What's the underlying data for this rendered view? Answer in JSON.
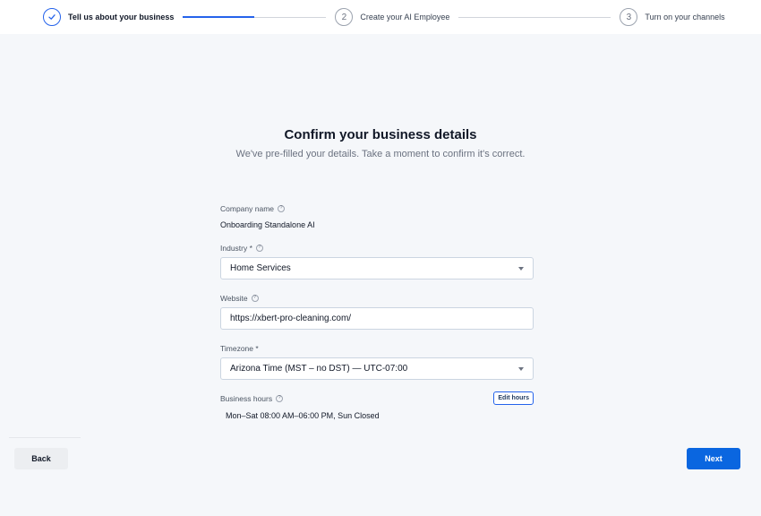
{
  "stepper": {
    "steps": [
      {
        "number": "",
        "label": "Tell us about your business",
        "state": "completed"
      },
      {
        "number": "2",
        "label": "Create your AI Employee",
        "state": "upcoming"
      },
      {
        "number": "3",
        "label": "Turn on your channels",
        "state": "upcoming"
      }
    ],
    "progress": 0.5
  },
  "page": {
    "title": "Confirm your business details",
    "subtitle": "We've pre-filled your details. Take a moment to confirm it's correct."
  },
  "form": {
    "company_name": {
      "label": "Company name",
      "value": "Onboarding Standalone AI"
    },
    "industry": {
      "label": "Industry *",
      "value": "Home Services"
    },
    "website": {
      "label": "Website",
      "value": "https://xbert-pro-cleaning.com/"
    },
    "timezone": {
      "label": "Timezone *",
      "value": "Arizona Time (MST – no DST) — UTC-07:00"
    },
    "business_hours": {
      "label": "Business hours",
      "value": "Mon–Sat 08:00 AM–06:00 PM, Sun Closed",
      "edit_label": "Edit hours"
    }
  },
  "footer": {
    "back_label": "Back",
    "next_label": "Next"
  },
  "colors": {
    "accent": "#0a66e0",
    "step_active": "#2563eb",
    "background": "#f5f7fa"
  },
  "icons": {
    "check": "check-icon",
    "help": "help-circle-icon",
    "caret": "chevron-down-icon"
  }
}
